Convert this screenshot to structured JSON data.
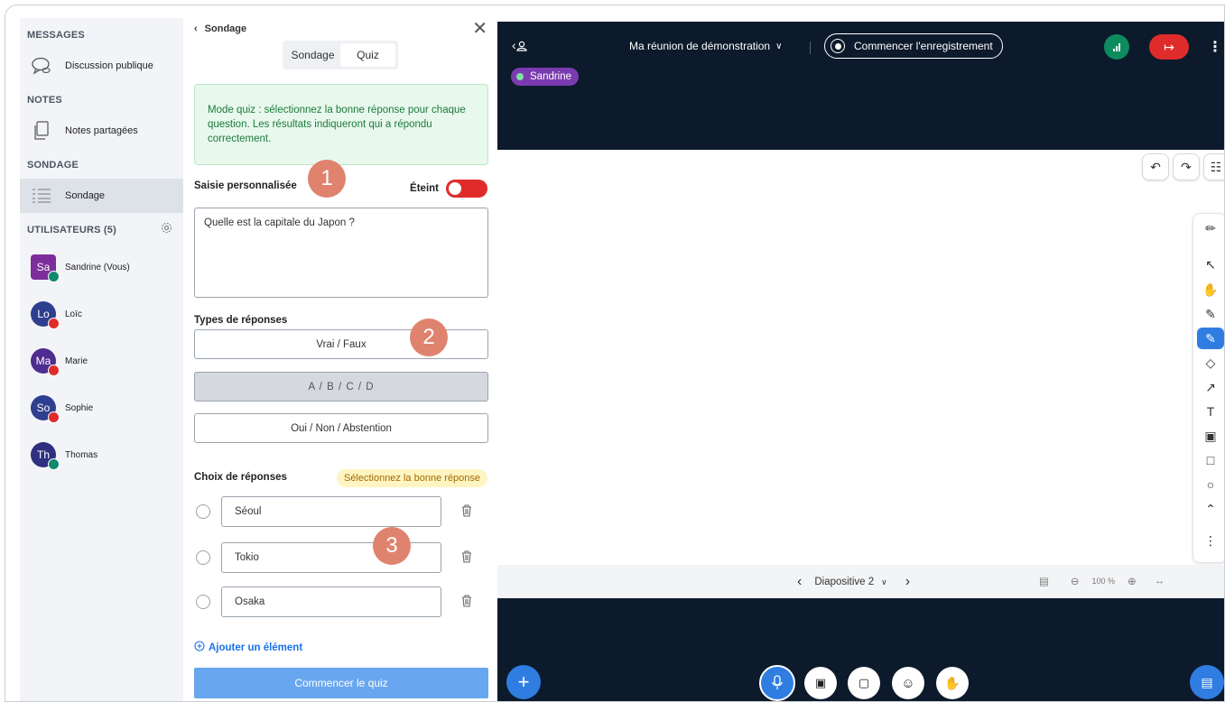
{
  "sidebar": {
    "messages_title": "MESSAGES",
    "public_chat": "Discussion publique",
    "notes_title": "NOTES",
    "shared_notes": "Notes partagées",
    "poll_title": "SONDAGE",
    "poll_item": "Sondage",
    "users_title": "UTILISATEURS (5)",
    "users": [
      {
        "initials": "Sa",
        "name": "Sandrine (Vous)",
        "color": "#7c2d9b",
        "mic": "#0f8a6c"
      },
      {
        "initials": "Lo",
        "name": "Loïc",
        "color": "#2f3f8f",
        "mic": "#e02b2b"
      },
      {
        "initials": "Ma",
        "name": "Marie",
        "color": "#4f2c8f",
        "mic": "#e02b2b"
      },
      {
        "initials": "So",
        "name": "Sophie",
        "color": "#2f3f8f",
        "mic": "#e02b2b"
      },
      {
        "initials": "Th",
        "name": "Thomas",
        "color": "#2f2f7f",
        "mic": "#0f8a6c"
      }
    ]
  },
  "poll": {
    "header": "Sondage",
    "tabs": [
      "Sondage",
      "Quiz"
    ],
    "info": "Mode quiz : sélectionnez la bonne réponse pour chaque question. Les résultats indiqueront qui a répondu correctement.",
    "custom_input_label": "Saisie personnalisée",
    "toggle_label": "Éteint",
    "question": "Quelle est la capitale du Japon ?",
    "response_types_label": "Types de réponses",
    "response_types": [
      "Vrai / Faux",
      "A / B / C / D",
      "Oui / Non / Abstention"
    ],
    "choices_label": "Choix de réponses",
    "choices_hint": "Sélectionnez la bonne réponse",
    "choices": [
      "Séoul",
      "Tokio",
      "Osaka"
    ],
    "add_item": "Ajouter un élément",
    "start_quiz": "Commencer le quiz",
    "badges": [
      "1",
      "2",
      "3"
    ]
  },
  "meeting": {
    "title": "Ma réunion de démonstration",
    "record": "Commencer l'enregistrement",
    "talker": "Sandrine",
    "slide_label": "Diapositive 2",
    "zoom": "100 %"
  },
  "colors": {
    "accent": "#1a73e8",
    "danger": "#e02b2b",
    "dark": "#0c1a2b",
    "success": "#0d8b5f"
  }
}
